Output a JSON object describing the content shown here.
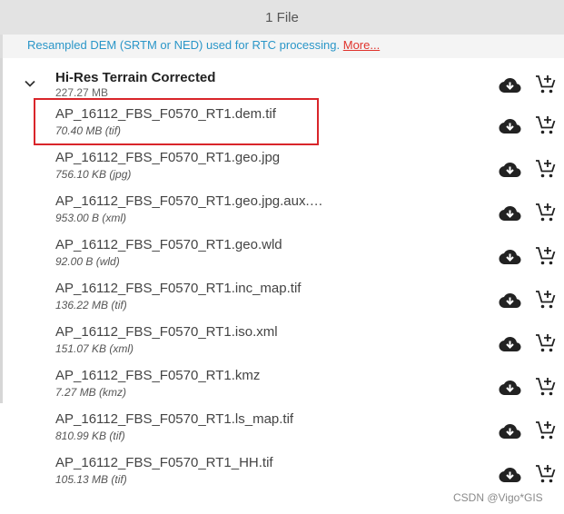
{
  "header": {
    "title": "1 File"
  },
  "info": {
    "text": "Resampled DEM (SRTM or NED) used for RTC processing.",
    "more_link": "More..."
  },
  "group": {
    "title": "Hi-Res Terrain Corrected",
    "size": "227.27 MB",
    "expand_icon": "chevron-down-icon"
  },
  "files": [
    {
      "name": "AP_16112_FBS_F0570_RT1.dem.tif",
      "size": "70.40 MB (tif)"
    },
    {
      "name": "AP_16112_FBS_F0570_RT1.geo.jpg",
      "size": "756.10 KB (jpg)"
    },
    {
      "name": "AP_16112_FBS_F0570_RT1.geo.jpg.aux.…",
      "size": "953.00 B (xml)"
    },
    {
      "name": "AP_16112_FBS_F0570_RT1.geo.wld",
      "size": "92.00 B (wld)"
    },
    {
      "name": "AP_16112_FBS_F0570_RT1.inc_map.tif",
      "size": "136.22 MB (tif)"
    },
    {
      "name": "AP_16112_FBS_F0570_RT1.iso.xml",
      "size": "151.07 KB (xml)"
    },
    {
      "name": "AP_16112_FBS_F0570_RT1.kmz",
      "size": "7.27 MB (kmz)"
    },
    {
      "name": "AP_16112_FBS_F0570_RT1.ls_map.tif",
      "size": "810.99 KB (tif)"
    },
    {
      "name": "AP_16112_FBS_F0570_RT1_HH.tif",
      "size": "105.13 MB (tif)"
    }
  ],
  "icons": {
    "download": "cloud-download-icon",
    "cart": "add-to-cart-icon"
  },
  "watermark": "CSDN @Vigo*GIS",
  "colors": {
    "info_text": "#2a96c8",
    "more_link": "#e0332c",
    "highlight_box": "#d9252a",
    "header_bg": "#e3e3e3"
  }
}
